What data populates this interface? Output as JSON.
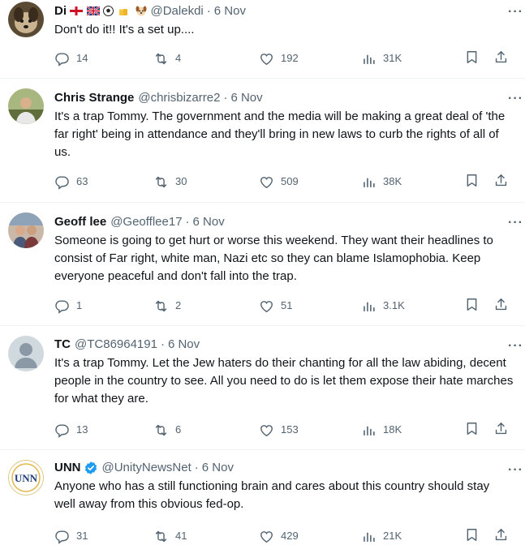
{
  "tweets": [
    {
      "name": "Di",
      "name_emojis": "🏴󠁧󠁢󠁥󠁮󠁧󠁿🇬🇧⚽🍻 🐶",
      "handle": "@Dalekdi",
      "time": "6 Nov",
      "text": "Don't do it!!  It's a set up....",
      "replies": "14",
      "retweets": "4",
      "likes": "192",
      "views": "31K",
      "avatar_color": "#6b5a3e"
    },
    {
      "name": "Chris Strange",
      "handle": "@chrisbizarre2",
      "time": "6 Nov",
      "text": "It's a trap Tommy. The government and the media will be making a great deal of 'the far right' being in attendance and they'll bring in new laws to curb the rights of all of us.",
      "replies": "63",
      "retweets": "30",
      "likes": "509",
      "views": "38K",
      "avatar_color": "#7d8a5c"
    },
    {
      "name": "Geoff lee",
      "handle": "@Geofflee17",
      "time": "6 Nov",
      "text": "Someone is going to get hurt or worse this weekend. They want their headlines to consist of Far right, white man, Nazi etc so they can blame Islamophobia. Keep everyone peaceful and don't fall into the trap.",
      "replies": "1",
      "retweets": "2",
      "likes": "51",
      "views": "3.1K",
      "avatar_color": "#8a7a6a"
    },
    {
      "name": "TC",
      "handle": "@TC86964191",
      "time": "6 Nov",
      "text": "It's a trap Tommy. Let the Jew haters do their chanting for all the law abiding, decent people in the country to see. All you need to do is let them expose their hate marches for what they are.",
      "replies": "13",
      "retweets": "6",
      "likes": "153",
      "views": "18K",
      "avatar_color": "#cfd9de"
    },
    {
      "name": "UNN",
      "handle": "@UnityNewsNet",
      "time": "6 Nov",
      "text": "Anyone who has a still functioning brain and cares about this country should stay well away from this obvious fed-op.",
      "replies": "31",
      "retweets": "41",
      "likes": "429",
      "views": "21K",
      "avatar_text": "UNN",
      "accent": "#1d9bf0"
    }
  ],
  "icons": {
    "reply": "reply-icon",
    "retweet": "retweet-icon",
    "like": "heart-icon",
    "views": "views-icon",
    "bookmark": "bookmark-icon",
    "share": "share-icon",
    "more": "more-icon"
  }
}
